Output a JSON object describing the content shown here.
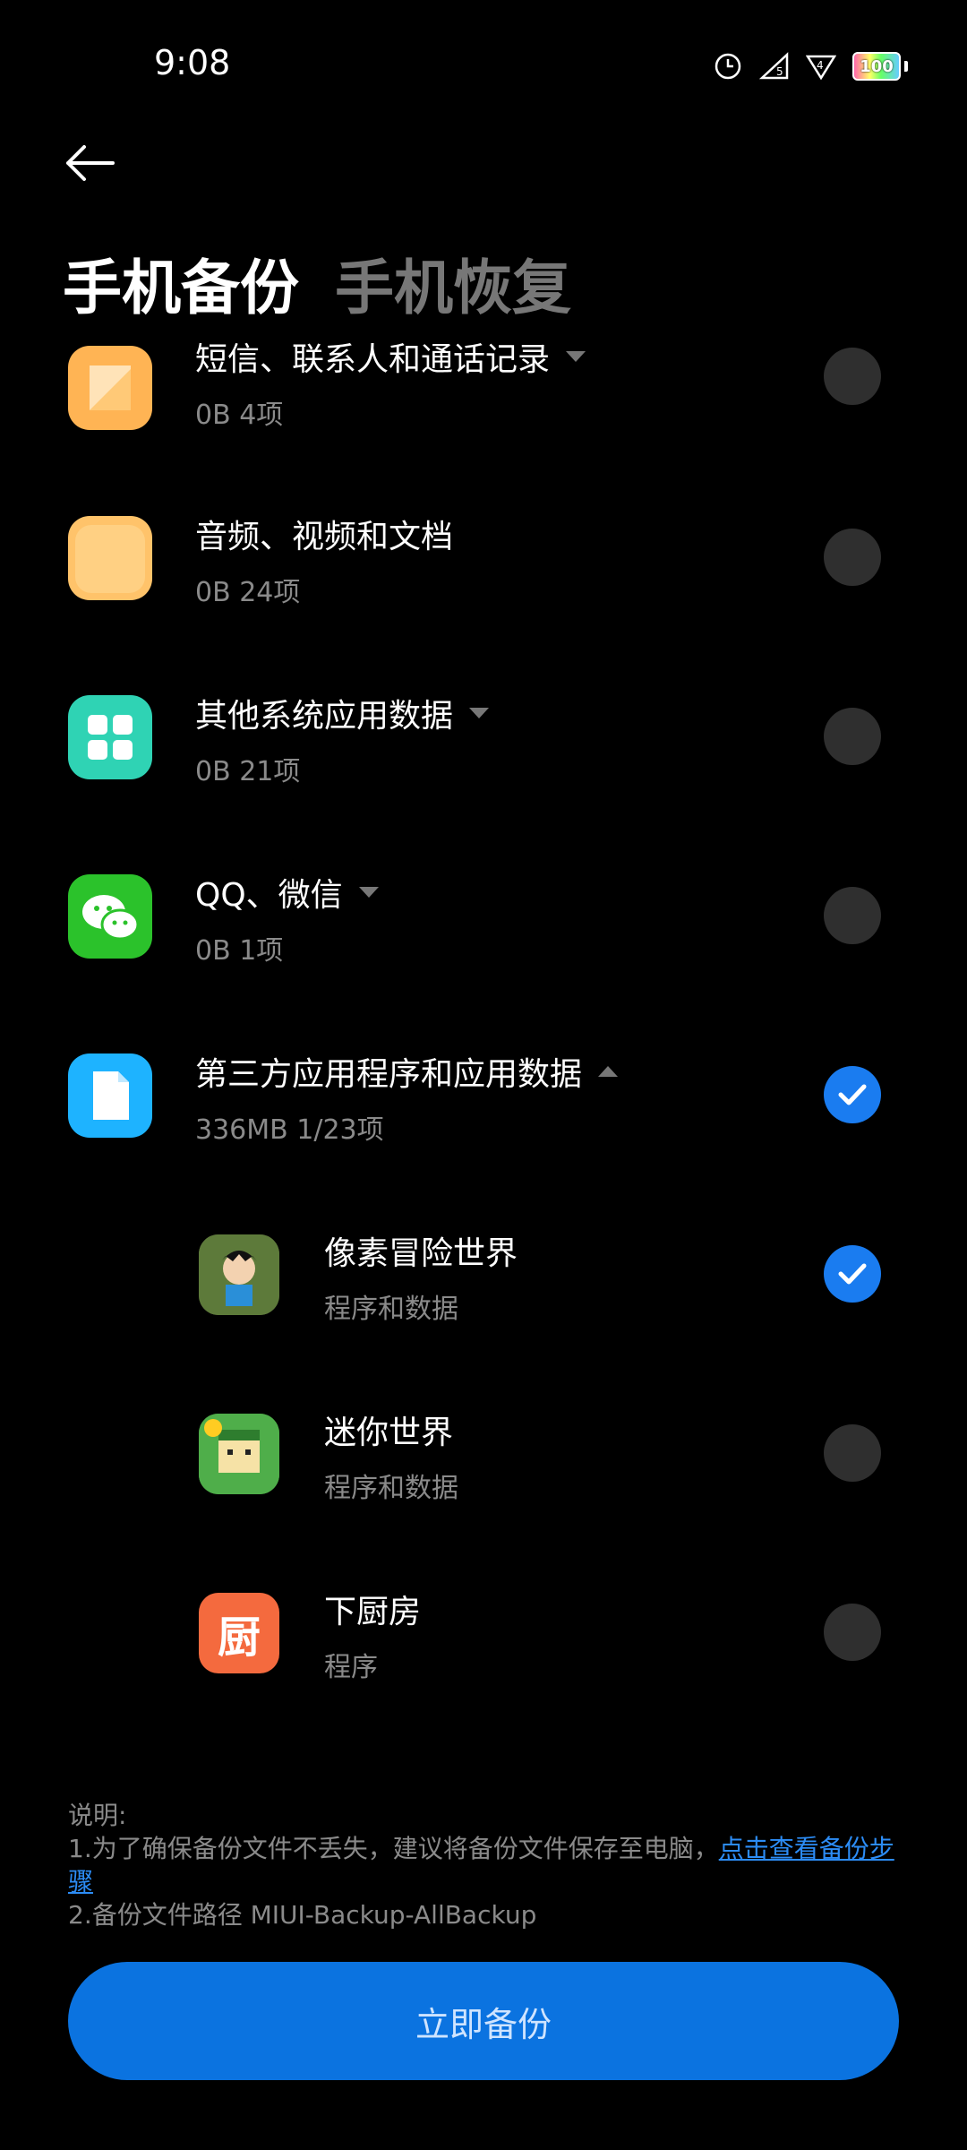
{
  "status": {
    "time": "9:08",
    "battery": "100"
  },
  "tabs": [
    {
      "label": "手机备份",
      "active": true
    },
    {
      "label": "手机恢复",
      "active": false
    }
  ],
  "items": [
    {
      "title": "短信、联系人和通话记录",
      "subtitle": "0B 4项",
      "caret": "down",
      "checked": false,
      "icon": "sms-contacts-icon"
    },
    {
      "title": "音频、视频和文档",
      "subtitle": "0B 24项",
      "caret": "",
      "checked": false,
      "icon": "folder-icon"
    },
    {
      "title": "其他系统应用数据",
      "subtitle": "0B 21项",
      "caret": "down",
      "checked": false,
      "icon": "apps-grid-icon"
    },
    {
      "title": "QQ、微信",
      "subtitle": "0B 1项",
      "caret": "down",
      "checked": false,
      "icon": "wechat-icon"
    },
    {
      "title": "第三方应用程序和应用数据",
      "subtitle": "336MB 1/23项",
      "caret": "up",
      "checked": true,
      "icon": "document-icon"
    }
  ],
  "sub_items": [
    {
      "title": "像素冒险世界",
      "subtitle": "程序和数据",
      "checked": true,
      "icon": "pixel-adventure-app-icon"
    },
    {
      "title": "迷你世界",
      "subtitle": "程序和数据",
      "checked": false,
      "icon": "mini-world-app-icon"
    },
    {
      "title": "下厨房",
      "subtitle": "程序",
      "checked": false,
      "icon": "xiachufang-app-icon",
      "icon_text": "厨"
    }
  ],
  "notes": {
    "heading": "说明:",
    "line1": "1.为了确保备份文件不丢失，建议将备份文件保存至电脑，",
    "line1_link": "点击查看备份步骤",
    "line2": "2.备份文件路径 MIUI-Backup-AllBackup"
  },
  "backup_button": {
    "label": "立即备份"
  },
  "colors": {
    "accent": "#1a7cf0",
    "button": "#0b73e0",
    "link": "#2c8cf5"
  }
}
